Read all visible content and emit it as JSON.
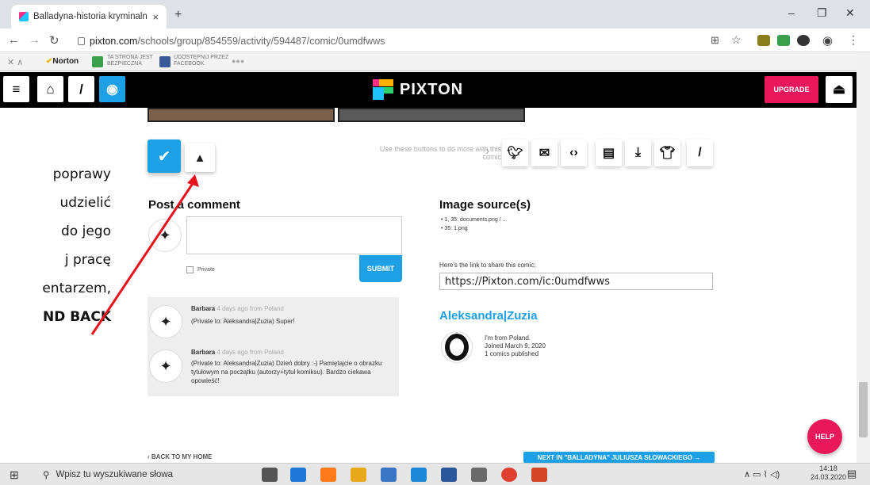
{
  "browser": {
    "tab_title": "Balladyna-historia kryminalna by",
    "tab_close": "×",
    "new_tab": "+",
    "url_host": "pixton.com",
    "url_path": "/schools/group/854559/activity/594487/comic/0umdfwws",
    "win_min": "–",
    "win_restore": "❐",
    "win_close": "✕"
  },
  "norton": {
    "brand": "Norton",
    "safe_line1": "TA STRONA JEST",
    "safe_line2": "BEZPIECZNA",
    "share_line1": "UDOSTĘPNIJ PRZEZ",
    "share_line2": "FACEBOOK"
  },
  "pixton": {
    "logo_text": "PIXTON",
    "upgrade_label": "UPGRADE"
  },
  "doc_fragment": {
    "lines": [
      "poprawy",
      "udzielić",
      "do jego",
      "j   pracę",
      "entarzem,",
      "ND BACK"
    ]
  },
  "actions": {
    "hint": "Use these buttons to do more with this comic"
  },
  "comment_form": {
    "heading": "Post a comment",
    "private_label": "Private",
    "submit_label": "SUBMIT"
  },
  "comments": [
    {
      "author": "Barbara",
      "meta": "4 days ago from Poland",
      "text": "(Private to: Aleksandra|Zuzia) Super!"
    },
    {
      "author": "Barbara",
      "meta": "4 days ago from Poland",
      "text": "(Private to: Aleksandra|Zuzia) Dzień dobry :-) Pamiętajcie o obrazku tytułowym na początku (autorzy+tytuł komiksu). Bardzo ciekawa opowieść!"
    }
  ],
  "image_sources": {
    "heading": "Image source(s)",
    "items": [
      "1, 35: documents.png / ...",
      "35: 1.png"
    ],
    "share_label": "Here's the link to share this comic:",
    "share_link": "https://Pixton.com/ic:0umdfwws"
  },
  "author": {
    "name": "Aleksandra|Zuzia",
    "line1": "I'm from Poland.",
    "line2": "Joined March 9, 2020",
    "line3": "1 comics published"
  },
  "footer": {
    "back_label": "BACK TO MY HOME",
    "next_label": "NEXT IN \"BALLADYNA\" JULIUSZA SŁOWACKIEGO →",
    "help_label": "HELP"
  },
  "taskbar": {
    "search_placeholder": "Wpisz tu wyszukiwane słowa",
    "time": "14:18",
    "date": "24.03.2020"
  },
  "colors": {
    "pixton_blue": "#1ea0e6",
    "pixton_pink": "#e8185a",
    "annotation_arrow": "#e8101a"
  }
}
